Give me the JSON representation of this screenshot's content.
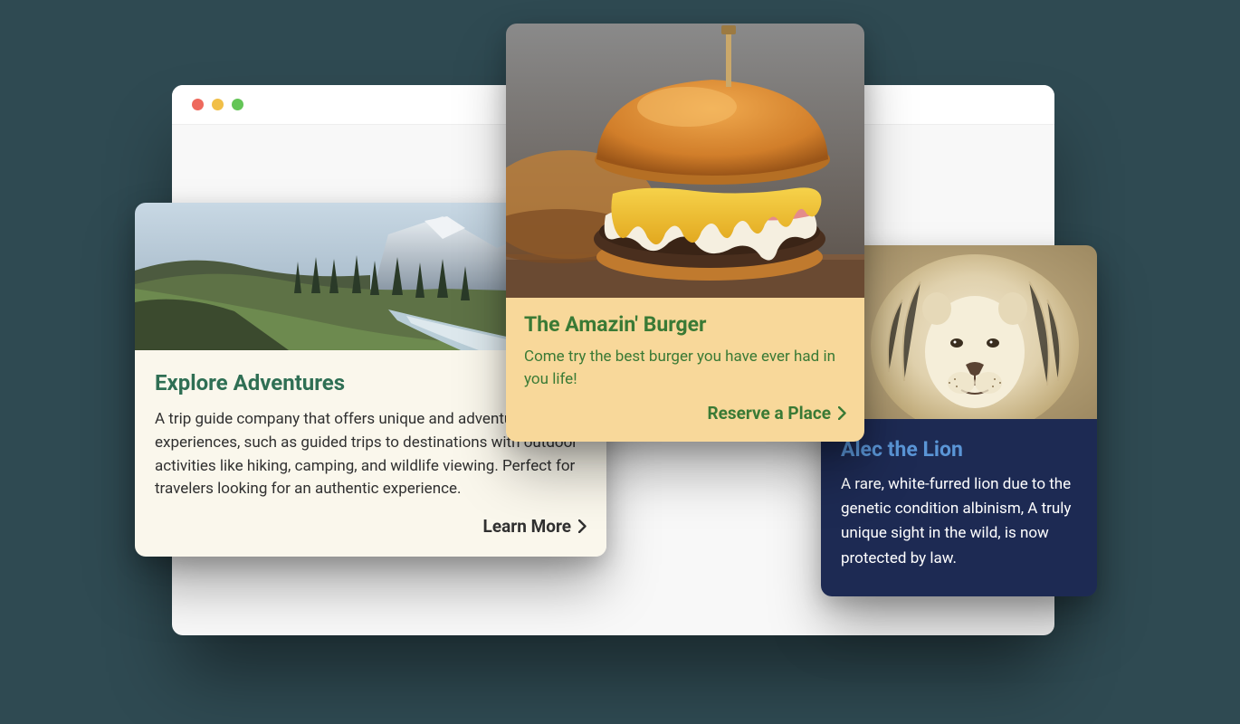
{
  "cards": [
    {
      "title": "Explore Adventures",
      "description": "A trip guide company that offers unique and adventure experiences, such as guided trips to destinations with outdoor activities like hiking, camping, and wildlife viewing. Perfect for travelers looking for an authentic experience.",
      "cta": "Learn More",
      "image": "mountain-landscape"
    },
    {
      "title": "The Amazin' Burger",
      "description": "Come try the best burger you have ever had in you life!",
      "cta": "Reserve a Place",
      "image": "burger"
    },
    {
      "title": "Alec the Lion",
      "description": "A rare, white-furred lion due to the genetic condition albinism, A truly unique sight in the wild, is now protected by law.",
      "image": "white-lion"
    }
  ],
  "colors": {
    "background": "#2f4a52",
    "card1_bg": "#faf7ec",
    "card1_title": "#2f6f54",
    "card2_bg": "#f8d89a",
    "card2_title": "#3a7a35",
    "card3_bg": "#1d2a53",
    "card3_title": "#5a95d6"
  }
}
